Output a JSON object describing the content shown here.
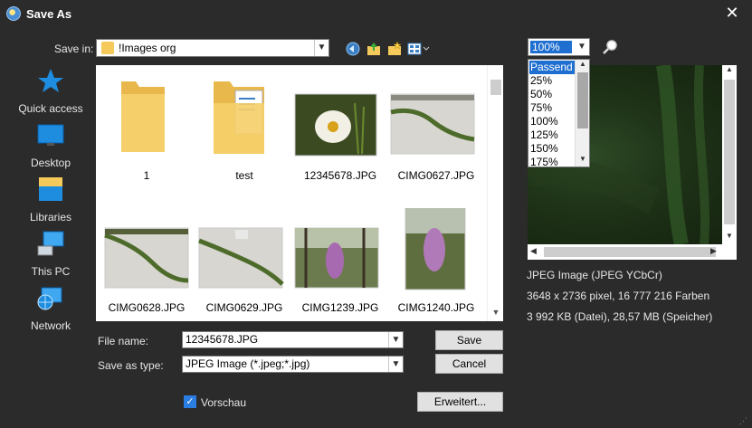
{
  "window": {
    "title": "Save As"
  },
  "toolbar": {
    "save_in_label": "Save in:",
    "save_in_value": "!Images org"
  },
  "sidebar": {
    "items": [
      {
        "label": "Quick access",
        "icon": "quick-access-star-icon"
      },
      {
        "label": "Desktop",
        "icon": "desktop-icon"
      },
      {
        "label": "Libraries",
        "icon": "libraries-icon"
      },
      {
        "label": "This PC",
        "icon": "computer-icon"
      },
      {
        "label": "Network",
        "icon": "network-icon"
      }
    ]
  },
  "files": [
    {
      "name": "1",
      "kind": "folder"
    },
    {
      "name": "test",
      "kind": "folder"
    },
    {
      "name": "12345678.JPG",
      "kind": "image"
    },
    {
      "name": "CIMG0627.JPG",
      "kind": "image"
    },
    {
      "name": "CIMG0628.JPG",
      "kind": "image"
    },
    {
      "name": "CIMG0629.JPG",
      "kind": "image"
    },
    {
      "name": "CIMG1239.JPG",
      "kind": "image"
    },
    {
      "name": "CIMG1240.JPG",
      "kind": "image"
    }
  ],
  "form": {
    "filename_label": "File name:",
    "filename_value": "12345678.JPG",
    "type_label": "Save as type:",
    "type_value": "JPEG Image (*.jpeg;*.jpg)",
    "save_label": "Save",
    "cancel_label": "Cancel",
    "advanced_label": "Erweitert...",
    "preview_checkbox_label": "Vorschau",
    "preview_checked": true
  },
  "zoom": {
    "selected": "100%",
    "options": [
      "Passend",
      "25%",
      "50%",
      "75%",
      "100%",
      "125%",
      "150%",
      "175%"
    ],
    "highlighted": "Passend"
  },
  "image_info": {
    "format": "JPEG Image (JPEG YCbCr)",
    "dimensions": "3648 x 2736 pixel, 16 777 216 Farben",
    "size": "3 992 KB (Datei), 28,57 MB (Speicher)"
  },
  "colors": {
    "background": "#2b2b2b",
    "accent": "#1e6fd0",
    "folder": "#f5c95a"
  }
}
